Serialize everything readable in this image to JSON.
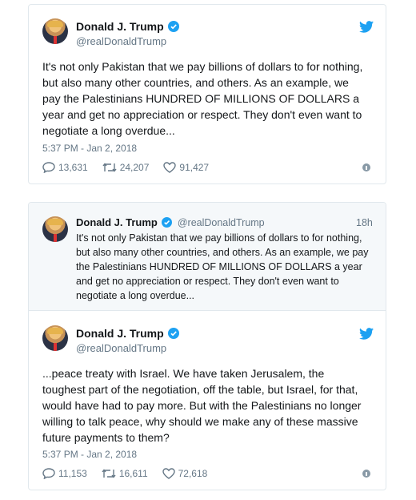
{
  "colors": {
    "accent": "#1da1f2",
    "muted": "#657786",
    "border": "#e1e8ed"
  },
  "tweet1": {
    "name": "Donald J. Trump",
    "handle": "@realDonaldTrump",
    "text_lines": [
      "It's not only Pakistan that we pay billions of dollars to for nothing,",
      "but also many other countries, and others. As an example, we",
      "pay the Palestinians HUNDRED OF MILLIONS OF DOLLARS a",
      "year and get no appreciation or respect. They don't even want to",
      "negotiate a long overdue..."
    ],
    "timestamp": "5:37 PM - Jan 2, 2018",
    "replies": "13,631",
    "retweets": "24,207",
    "likes": "91,427"
  },
  "quoted": {
    "name": "Donald J. Trump",
    "handle": "@realDonaldTrump",
    "time": "18h",
    "text_lines": [
      "It's not only Pakistan that we pay billions of dollars to for nothing,",
      "but also many other countries, and others. As an example, we pay",
      "the Palestinians HUNDRED OF MILLIONS OF DOLLARS a year",
      "and get no appreciation or respect. They don't even want to",
      "negotiate a long overdue..."
    ]
  },
  "tweet2": {
    "name": "Donald J. Trump",
    "handle": "@realDonaldTrump",
    "text_lines": [
      "...peace treaty with Israel. We have taken Jerusalem, the",
      "toughest part of the negotiation, off the table, but Israel, for that,",
      "would have had to pay more. But with the Palestinians no longer",
      "willing to talk peace, why should we make any of these massive",
      "future payments to them?"
    ],
    "timestamp": "5:37 PM - Jan 2, 2018",
    "replies": "11,153",
    "retweets": "16,611",
    "likes": "72,618"
  }
}
